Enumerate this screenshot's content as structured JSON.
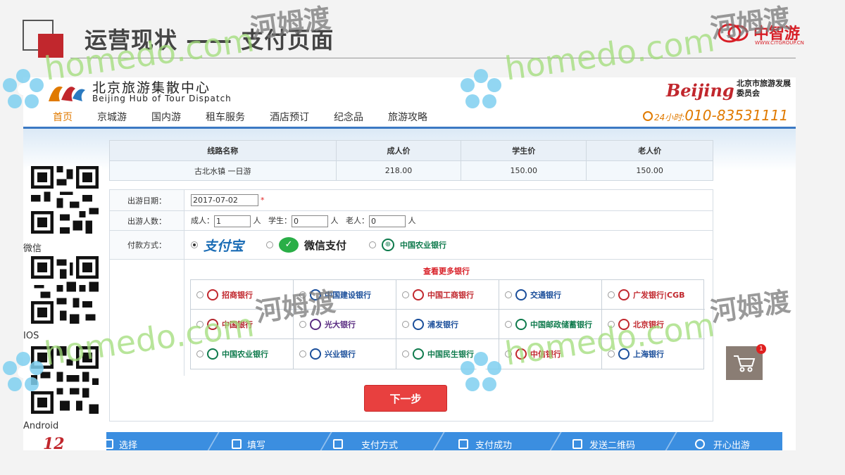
{
  "slide": {
    "title": "运营现状 —— 支付页面",
    "brand_name": "中智游",
    "brand_url": "WWW.CITGROUP.CN"
  },
  "site": {
    "name_cn": "北京旅游集散中心",
    "name_en": "Beijing Hub of Tour Dispatch",
    "partner_mark": "Beijing",
    "partner_cn": "北京市旅游发展委员会",
    "hotline_prefix": "24小时:",
    "hotline": "010-83531111",
    "nav": [
      {
        "label": "首页",
        "active": true
      },
      {
        "label": "京城游",
        "active": false
      },
      {
        "label": "国内游",
        "active": false
      },
      {
        "label": "租车服务",
        "active": false
      },
      {
        "label": "酒店预订",
        "active": false
      },
      {
        "label": "纪念品",
        "active": false
      },
      {
        "label": "旅游攻略",
        "active": false
      }
    ]
  },
  "qr": {
    "labels": [
      "微信",
      "IOS",
      "Android"
    ]
  },
  "price_table": {
    "headers": [
      "线路名称",
      "成人价",
      "学生价",
      "老人价"
    ],
    "rows": [
      [
        "古北水镇 一日游",
        "218.00",
        "150.00",
        "150.00"
      ]
    ]
  },
  "form": {
    "date_label": "出游日期：",
    "date_value": "2017-07-02",
    "date_required": "*",
    "count_label": "出游人数：",
    "adult_label": "成人：",
    "adult_value": "1",
    "student_label": "学生：",
    "student_value": "0",
    "senior_label": "老人：",
    "senior_value": "0",
    "unit": "人",
    "payment_label": "付款方式：",
    "payment_options": [
      "支付宝",
      "微信支付",
      "中国农业银行"
    ],
    "payment_selected": "支付宝",
    "more_banks": "查看更多银行",
    "banks": [
      {
        "name": "招商银行",
        "color": "#c1272d"
      },
      {
        "name": "中国建设银行",
        "color": "#1a4e9a"
      },
      {
        "name": "中国工商银行",
        "color": "#c1272d"
      },
      {
        "name": "交通银行",
        "color": "#1a4e9a"
      },
      {
        "name": "广发银行|CGB",
        "color": "#c1272d"
      },
      {
        "name": "中国银行",
        "color": "#b3262d"
      },
      {
        "name": "光大银行",
        "color": "#5a2d82"
      },
      {
        "name": "浦发银行",
        "color": "#1a4e9a"
      },
      {
        "name": "中国邮政储蓄银行",
        "color": "#0e7a4c"
      },
      {
        "name": "北京银行",
        "color": "#c1272d"
      },
      {
        "name": "中国农业银行",
        "color": "#0e7a4c"
      },
      {
        "name": "兴业银行",
        "color": "#1a4e9a"
      },
      {
        "name": "中国民生银行",
        "color": "#0e7a4c"
      },
      {
        "name": "中信银行",
        "color": "#c1272d"
      },
      {
        "name": "上海银行",
        "color": "#1a4e9a"
      }
    ],
    "next_button": "下一步"
  },
  "steps": [
    "选择",
    "填写",
    "支付方式",
    "支付成功",
    "发送二维码",
    "开心出游"
  ],
  "cart": {
    "badge": "1"
  },
  "watermark": {
    "text": "homedo.com",
    "text_cn": "河姆渡"
  },
  "colors": {
    "accent_red": "#c1272d",
    "nav_orange": "#e07a00",
    "step_blue": "#3b8ee0",
    "button_red": "#e8403f"
  }
}
